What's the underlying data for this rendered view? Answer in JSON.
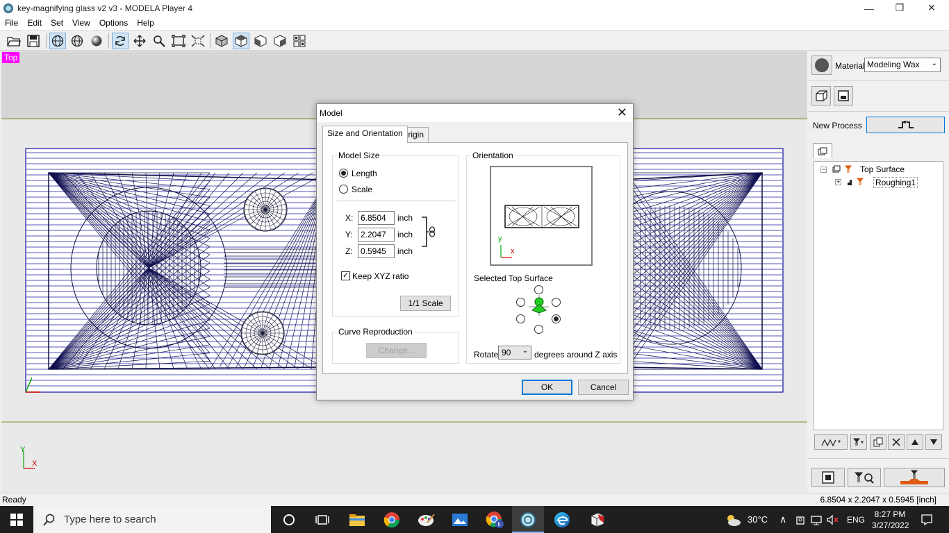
{
  "window": {
    "title": "key-magnifying glass v2 v3 - MODELA Player 4",
    "minimize_glyph": "—",
    "maximize_glyph": "❐",
    "close_glyph": "✕"
  },
  "menu": [
    "File",
    "Edit",
    "Set",
    "View",
    "Options",
    "Help"
  ],
  "toolbar_icons": [
    "open-icon",
    "save-icon",
    "wireframe-icon",
    "surface-icon",
    "render-icon",
    "rotate-icon",
    "move-icon",
    "zoom-icon",
    "fit-icon",
    "zoom-box-icon",
    "view-iso-icon",
    "view-top-icon",
    "view-front-icon",
    "view-side-icon",
    "view-multi-icon"
  ],
  "viewport": {
    "label": "Top",
    "axis_y": "Y",
    "axis_x": "X"
  },
  "right_panel": {
    "material_label": "Material",
    "material_value": "Modeling Wax",
    "new_process_label": "New Process",
    "tree": {
      "root": "Top Surface",
      "child": "Roughing1"
    }
  },
  "status": {
    "left": "Ready",
    "right": "6.8504 x 2.2047 x 0.5945 [inch]"
  },
  "dialog": {
    "title": "Model",
    "tabs": [
      "Size and Orientation",
      "Origin"
    ],
    "model_size": {
      "group_label": "Model Size",
      "length_label": "Length",
      "scale_label": "Scale",
      "x_label": "X:",
      "y_label": "Y:",
      "z_label": "Z:",
      "x_value": "6.8504",
      "y_value": "2.2047",
      "z_value": "0.5945",
      "unit": "inch",
      "keep_ratio_label": "Keep XYZ ratio",
      "keep_ratio_checked": true,
      "scale_button": "1/1 Scale"
    },
    "curve": {
      "group_label": "Curve Reproduction",
      "change_button": "Change..."
    },
    "orientation": {
      "group_label": "Orientation",
      "preview_y": "y",
      "preview_x": "x",
      "selected_top_surface_label": "Selected Top Surface",
      "rotate_label": "Rotate",
      "rotate_value": "90",
      "rotate_suffix": "degrees around Z axis"
    },
    "ok_button": "OK",
    "cancel_button": "Cancel"
  },
  "taskbar": {
    "search_placeholder": "Type here to search",
    "weather": "30°C",
    "language": "ENG",
    "time": "8:27 PM",
    "date": "3/27/2022"
  }
}
